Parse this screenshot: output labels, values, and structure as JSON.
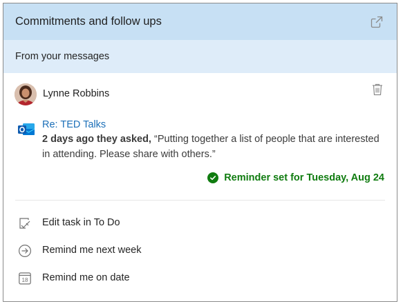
{
  "header": {
    "title": "Commitments and follow ups",
    "popout_icon": "open-in-new-window-icon"
  },
  "subheader": {
    "title": "From your messages"
  },
  "person": {
    "name": "Lynne Robbins",
    "delete_icon": "trash-icon"
  },
  "message": {
    "app_icon": "outlook-icon",
    "subject": "Re: TED Talks",
    "when": "2 days ago they asked,",
    "quote": "“Putting together a list of people that are interested in attending. Please share with others.”"
  },
  "reminder": {
    "text": "Reminder set for Tuesday, Aug 24",
    "color": "#107c10"
  },
  "actions": [
    {
      "icon": "edit-task-icon",
      "label": "Edit task in To Do"
    },
    {
      "icon": "arrow-right-circle-icon",
      "label": "Remind me next week"
    },
    {
      "icon": "calendar-icon",
      "calendar_day": "18",
      "label": "Remind me on date"
    }
  ],
  "colors": {
    "header_bg": "#c7e0f4",
    "subheader_bg": "#deecf9",
    "link": "#1b6fb8"
  }
}
